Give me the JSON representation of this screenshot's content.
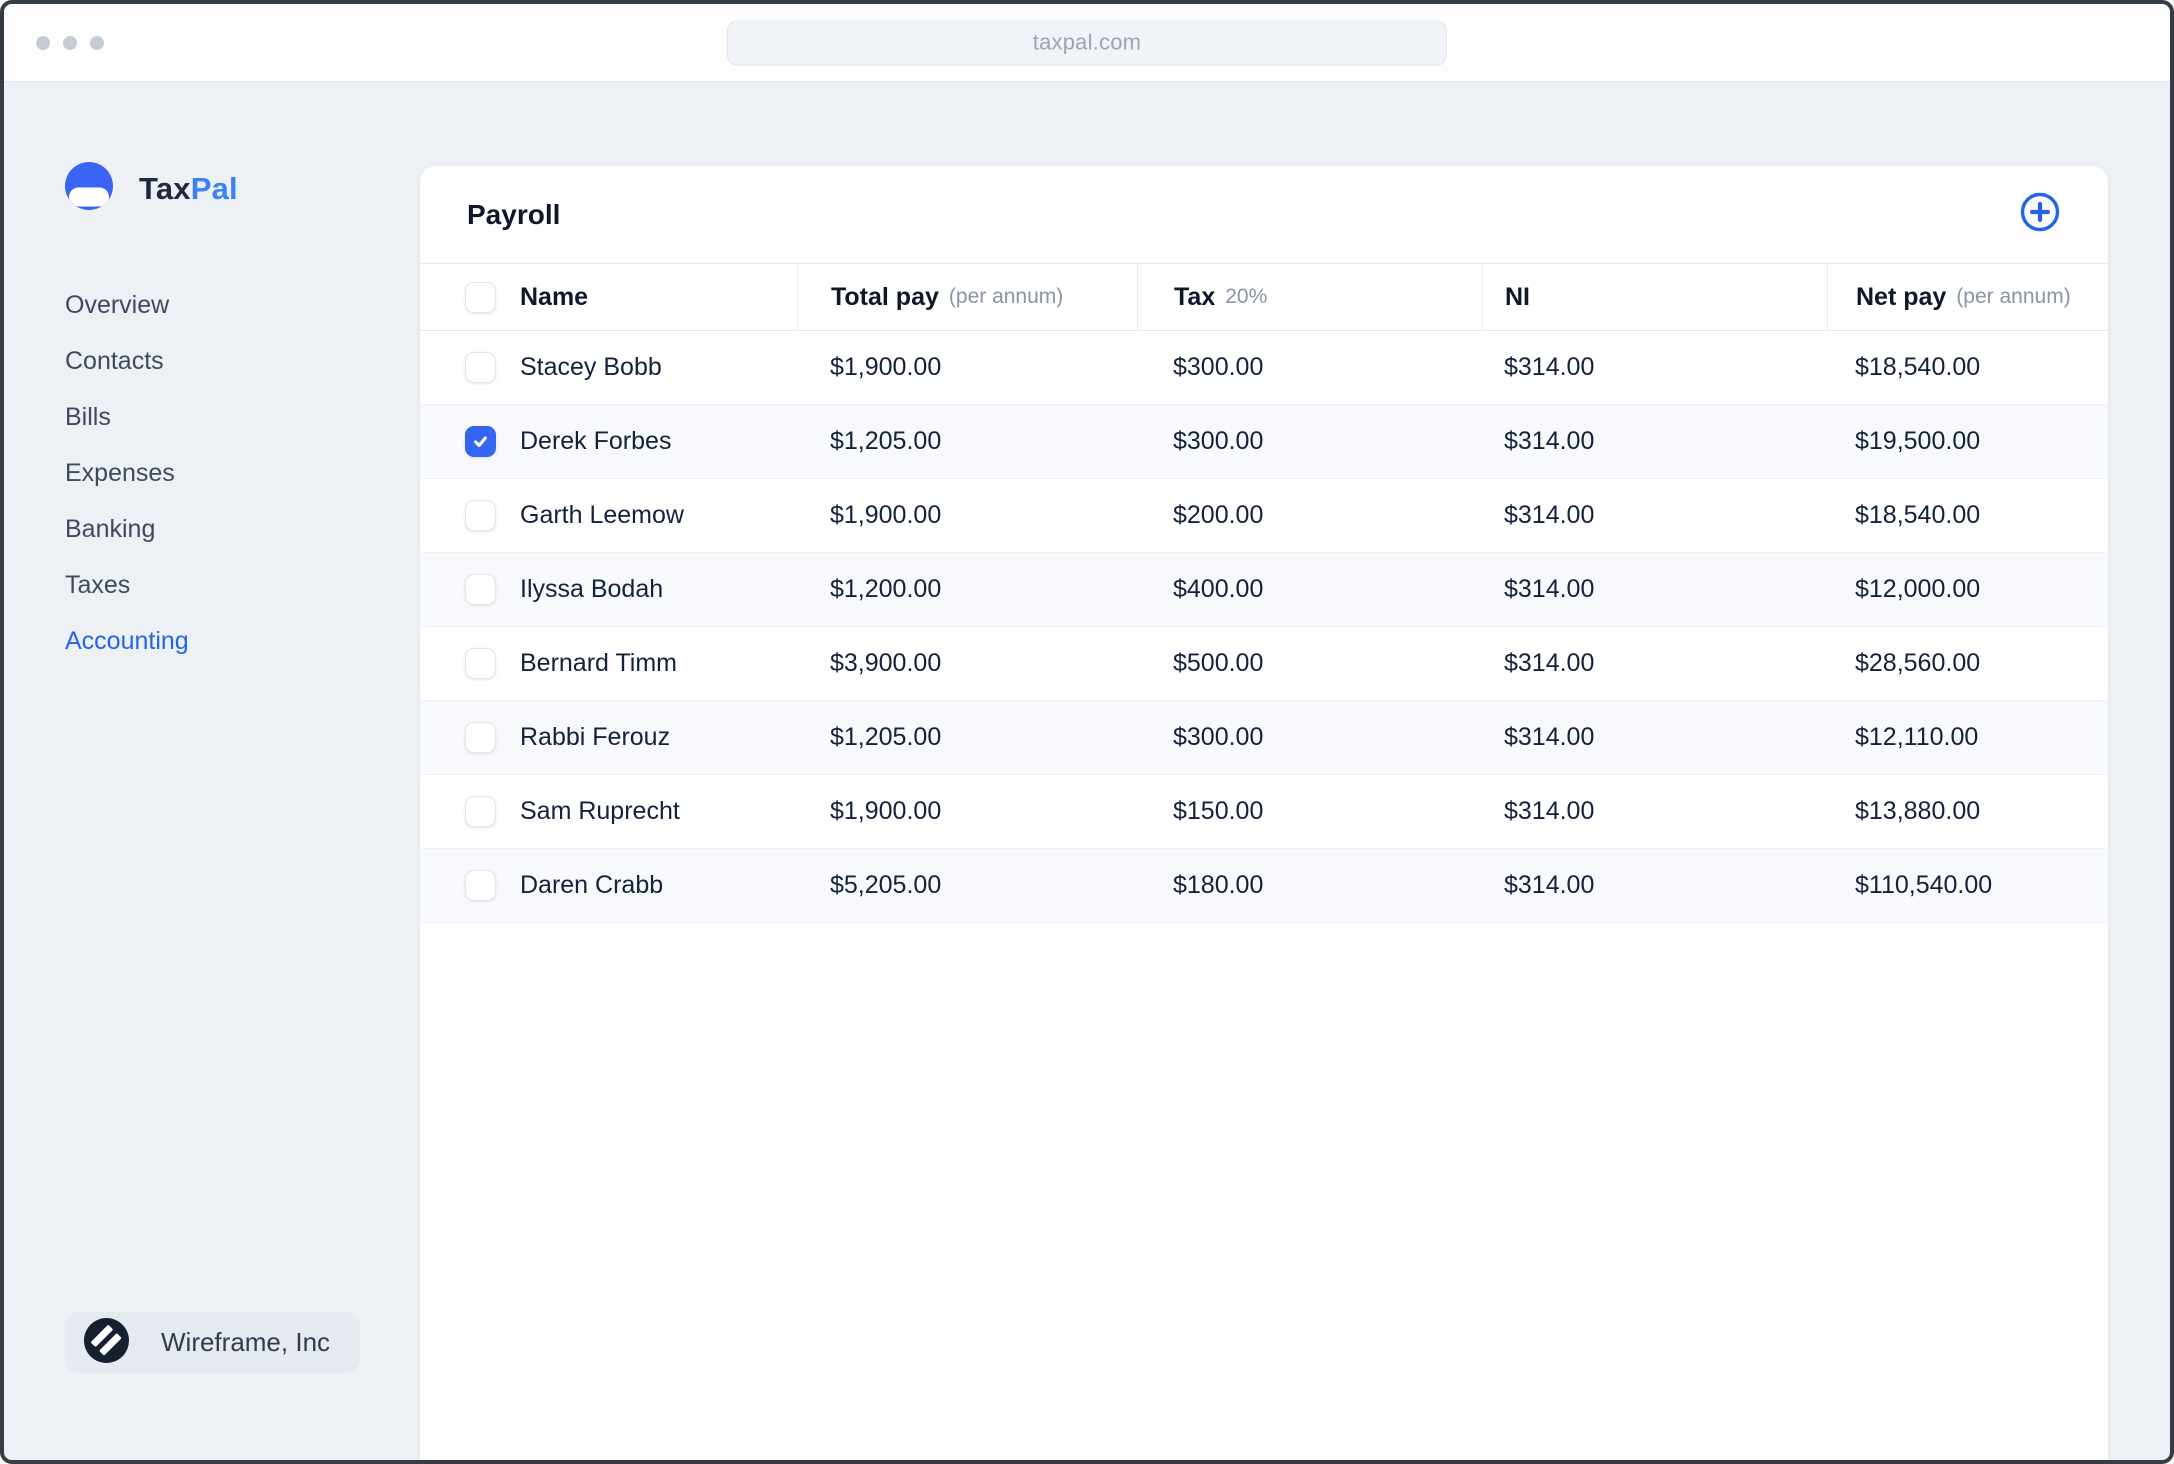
{
  "browser": {
    "url": "taxpal.com",
    "window_dots": 3
  },
  "brand": {
    "name_primary": "Tax",
    "name_secondary": "Pal"
  },
  "colors": {
    "accent_blue": "#2563eb",
    "logo_blue": "#3c64f4",
    "pal_blue": "#3b82f6",
    "checkbox_blue": "#3466f2",
    "dark_navy": "#16202f",
    "page_bg": "#edf1f6",
    "text_dark": "#0f172a"
  },
  "icons": {
    "add": "plus-circle",
    "logo": "taxpal-circle",
    "company": "wireframe-slashes",
    "check": "checkmark"
  },
  "sidebar": {
    "items": [
      {
        "label": "Overview",
        "active": false
      },
      {
        "label": "Contacts",
        "active": false
      },
      {
        "label": "Bills",
        "active": false
      },
      {
        "label": "Expenses",
        "active": false
      },
      {
        "label": "Banking",
        "active": false
      },
      {
        "label": "Taxes",
        "active": false
      },
      {
        "label": "Accounting",
        "active": true
      }
    ]
  },
  "footer": {
    "company": "Wireframe, Inc"
  },
  "payroll": {
    "title": "Payroll",
    "columns": {
      "name": "Name",
      "total_pay": "Total pay",
      "total_pay_suffix": "(per annum)",
      "tax": "Tax",
      "tax_suffix": "20%",
      "ni": "NI",
      "net_pay": "Net pay",
      "net_pay_suffix": "(per annum)"
    },
    "rows": [
      {
        "name": "Stacey Bobb",
        "total_pay": "$1,900.00",
        "tax": "$300.00",
        "ni": "$314.00",
        "net_pay": "$18,540.00",
        "checked": false
      },
      {
        "name": "Derek Forbes",
        "total_pay": "$1,205.00",
        "tax": "$300.00",
        "ni": "$314.00",
        "net_pay": "$19,500.00",
        "checked": true
      },
      {
        "name": "Garth Leemow",
        "total_pay": "$1,900.00",
        "tax": "$200.00",
        "ni": "$314.00",
        "net_pay": "$18,540.00",
        "checked": false
      },
      {
        "name": "Ilyssa Bodah",
        "total_pay": "$1,200.00",
        "tax": "$400.00",
        "ni": "$314.00",
        "net_pay": "$12,000.00",
        "checked": false
      },
      {
        "name": "Bernard Timm",
        "total_pay": "$3,900.00",
        "tax": "$500.00",
        "ni": "$314.00",
        "net_pay": "$28,560.00",
        "checked": false
      },
      {
        "name": "Rabbi Ferouz",
        "total_pay": "$1,205.00",
        "tax": "$300.00",
        "ni": "$314.00",
        "net_pay": "$12,110.00",
        "checked": false
      },
      {
        "name": "Sam Ruprecht",
        "total_pay": "$1,900.00",
        "tax": "$150.00",
        "ni": "$314.00",
        "net_pay": "$13,880.00",
        "checked": false
      },
      {
        "name": "Daren Crabb",
        "total_pay": "$5,205.00",
        "tax": "$180.00",
        "ni": "$314.00",
        "net_pay": "$110,540.00",
        "checked": false
      }
    ]
  }
}
